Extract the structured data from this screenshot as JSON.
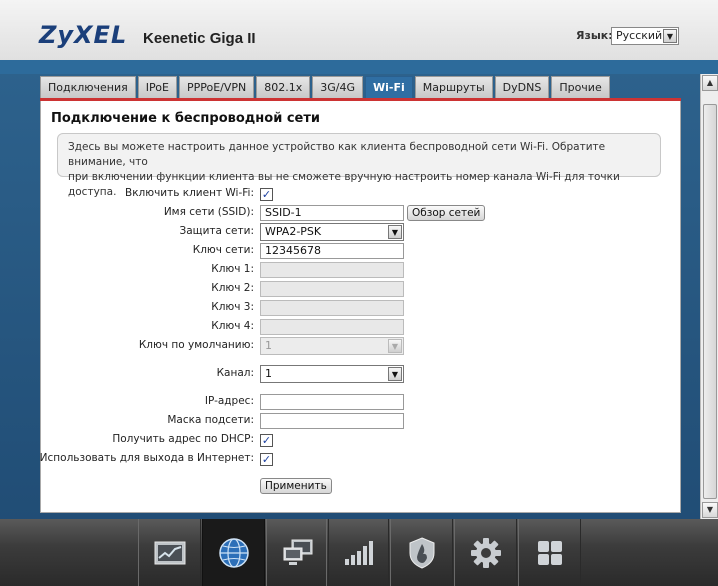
{
  "header": {
    "logo": "ZyXEL",
    "product": "Keenetic Giga II",
    "language_label": "Язык:",
    "language_value": "Русский"
  },
  "tabs": [
    {
      "label": "Подключения",
      "active": false
    },
    {
      "label": "IPoE",
      "active": false
    },
    {
      "label": "PPPoE/VPN",
      "active": false
    },
    {
      "label": "802.1x",
      "active": false
    },
    {
      "label": "3G/4G",
      "active": false
    },
    {
      "label": "Wi-Fi",
      "active": true
    },
    {
      "label": "Маршруты",
      "active": false
    },
    {
      "label": "DyDNS",
      "active": false
    },
    {
      "label": "Прочие",
      "active": false
    }
  ],
  "page": {
    "title": "Подключение к беспроводной сети",
    "info_line1": "Здесь вы можете настроить данное устройство как клиента беспроводной сети Wi-Fi. Обратите внимание, что",
    "info_line2": "при включении функции клиента вы не сможете вручную настроить номер канала Wi-Fi для точки доступа."
  },
  "form": {
    "enable_client": {
      "label": "Включить клиент Wi-Fi:",
      "checked": true
    },
    "ssid": {
      "label": "Имя сети (SSID):",
      "value": "SSID-1"
    },
    "scan_button": "Обзор сетей",
    "security": {
      "label": "Защита сети:",
      "value": "WPA2-PSK"
    },
    "network_key": {
      "label": "Ключ сети:",
      "value": "12345678"
    },
    "key1": {
      "label": "Ключ 1:",
      "value": ""
    },
    "key2": {
      "label": "Ключ 2:",
      "value": ""
    },
    "key3": {
      "label": "Ключ 3:",
      "value": ""
    },
    "key4": {
      "label": "Ключ 4:",
      "value": ""
    },
    "default_key": {
      "label": "Ключ по умолчанию:",
      "value": "1"
    },
    "channel": {
      "label": "Канал:",
      "value": "1"
    },
    "ip_address": {
      "label": "IP-адрес:",
      "value": ""
    },
    "subnet_mask": {
      "label": "Маска подсети:",
      "value": ""
    },
    "dhcp": {
      "label": "Получить адрес по DHCP:",
      "checked": true
    },
    "internet": {
      "label": "Использовать для выхода в Интернет:",
      "checked": true
    },
    "apply_button": "Применить"
  },
  "dock": [
    {
      "name": "monitor-icon",
      "active": false
    },
    {
      "name": "internet-globe-icon",
      "active": true
    },
    {
      "name": "home-network-icon",
      "active": false
    },
    {
      "name": "wifi-signal-icon",
      "active": false
    },
    {
      "name": "security-shield-icon",
      "active": false
    },
    {
      "name": "system-gear-icon",
      "active": false
    },
    {
      "name": "apps-grid-icon",
      "active": false
    }
  ],
  "colors": {
    "accent": "#2f6ea3",
    "tab_line": "#cc3333",
    "dock_bg": "#3c3c3c"
  }
}
